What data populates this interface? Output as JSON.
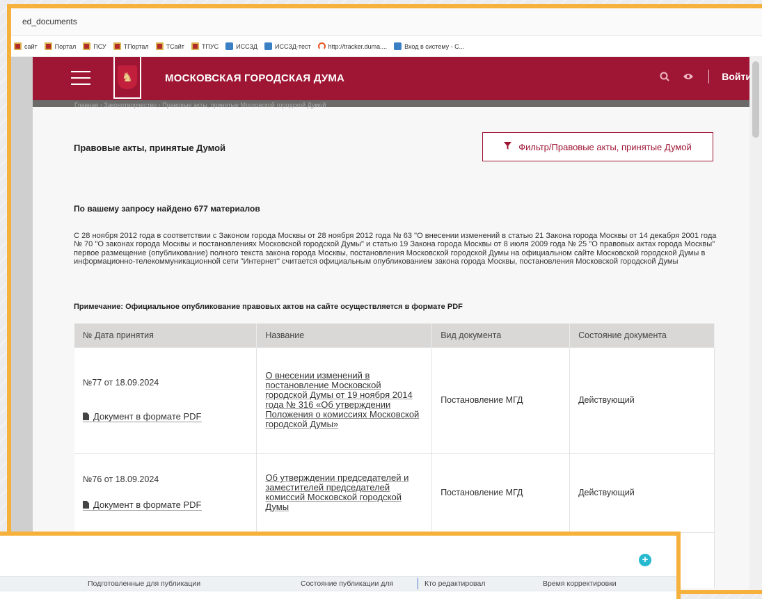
{
  "browser": {
    "address": "ed_documents",
    "bookmarks": [
      {
        "label": "сайт",
        "icon": "red"
      },
      {
        "label": "Портал",
        "icon": "red"
      },
      {
        "label": "ПСУ",
        "icon": "red"
      },
      {
        "label": "ТПортал",
        "icon": "red"
      },
      {
        "label": "ТСайт",
        "icon": "red"
      },
      {
        "label": "ТПУС",
        "icon": "red"
      },
      {
        "label": "ИССЗД",
        "icon": "blue"
      },
      {
        "label": "ИССЗД-тест",
        "icon": "blue"
      },
      {
        "label": "http://tracker.duma....",
        "icon": "track"
      },
      {
        "label": "Вход в систему - С...",
        "icon": "blue"
      }
    ]
  },
  "header": {
    "site_title": "МОСКОВСКАЯ ГОРОДСКАЯ ДУМА",
    "login": "Войти",
    "breadcrumb": "Главная  ›  Законотворчество  ›  Правовые акты, принятые Московской городской Думой"
  },
  "content": {
    "heading": "Правовые акты, принятые Думой",
    "filter_label": "Фильтр/Правовые акты, принятые Думой",
    "results": "По вашему запросу найдено 677 материалов",
    "legal_note": "С 28 ноября 2012 года в соответствии с Законом города Москвы от 28 ноября 2012 года № 63 \"О внесении изменений в статью 21 Закона города Москвы от 14 декабря 2001 года № 70 \"О законах города Москвы и постановлениях Московской городской Думы\" и статью 19 Закона города Москвы от 8 июля 2009 года № 25 \"О правовых актах города Москвы\" первое размещение (опубликование) полного текста закона города Москвы, постановления Московской городской Думы на официальном сайте Московской городской Думы в информационно-телекоммуникационной сети \"Интернет\" считается официальным опубликованием закона города Москвы, постановления Московской городской Думы",
    "publish_note": "Примечание: Официальное опубликование правовых актов на сайте осуществляется в формате PDF"
  },
  "table": {
    "headers": [
      "№ Дата принятия",
      "Название",
      "Вид документа",
      "Состояние документа"
    ],
    "rows": [
      {
        "number_date": "№77 от 18.09.2024",
        "pdf": "Документ в формате PDF",
        "title": "О внесении изменений в постановление Московской городской Думы от 19 ноября 2014 года № 316 «Об утверждении Положения о комиссиях Московской городской Думы»",
        "type": "Постановление МГД",
        "status": "Действующий"
      },
      {
        "number_date": "№76 от 18.09.2024",
        "pdf": "Документ в формате PDF",
        "title": "Об утверждении председателей и заместителей председателей комиссий Московской городской Думы",
        "type": "Постановление МГД",
        "status": "Действующий"
      }
    ]
  },
  "overlay": {
    "columns": [
      "Подготовленные для публикации",
      "Состояние публикации для",
      "Кто редактировал",
      "Время корректировки"
    ],
    "add_label": "+"
  }
}
